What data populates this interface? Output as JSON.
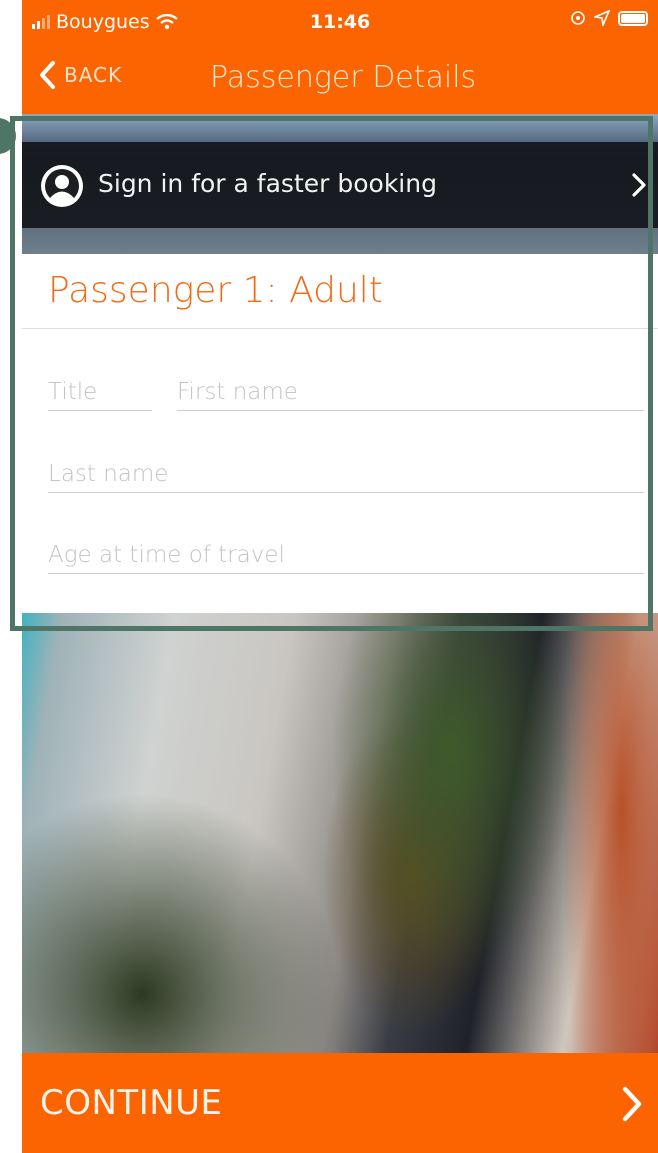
{
  "status_bar": {
    "carrier": "Bouygues",
    "time": "11:46"
  },
  "nav": {
    "back_label": "BACK",
    "title": "Passenger Details"
  },
  "signin": {
    "label": "Sign in for a faster booking"
  },
  "passenger": {
    "heading": "Passenger 1: Adult",
    "fields": {
      "title_placeholder": "Title",
      "first_name_placeholder": "First name",
      "last_name_placeholder": "Last name",
      "age_placeholder": "Age at time of travel"
    }
  },
  "footer": {
    "continue_label": "CONTINUE"
  },
  "colors": {
    "brand": "#fb6400",
    "heading": "#f36a16",
    "annotation": "#4e7566"
  }
}
